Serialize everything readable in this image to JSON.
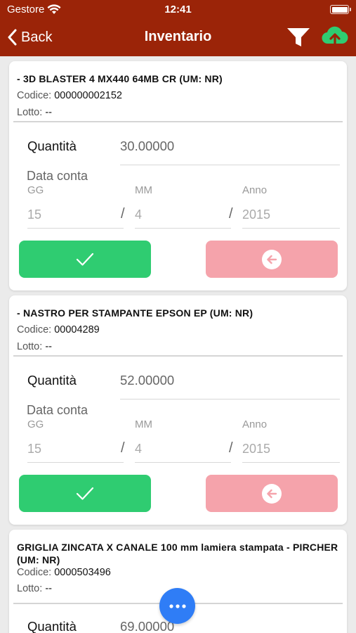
{
  "status_bar": {
    "carrier": "Gestore",
    "time": "12:41"
  },
  "nav": {
    "back_label": "Back",
    "title": "Inventario"
  },
  "colors": {
    "header": "#9b2408",
    "confirm": "#2fcc71",
    "back_button": "#f5a3ab",
    "fab": "#2f7df6",
    "upload_icon": "#2fcc71"
  },
  "icons": {
    "filter": "filter-icon",
    "upload": "cloud-upload-icon",
    "confirm": "checkmark-icon",
    "back": "arrow-left-circle-icon",
    "more": "more-dots-icon"
  },
  "labels": {
    "codice": "Codice:",
    "lotto": "Lotto:",
    "quantita": "Quantità",
    "data_conta": "Data conta",
    "gg": "GG",
    "mm": "MM",
    "anno": "Anno",
    "slash": "/"
  },
  "items": [
    {
      "title": "- 3D BLASTER 4 MX440 64MB CR (UM: NR)",
      "codice": "000000002152",
      "lotto": "--",
      "quantita": "30.00000",
      "gg": "15",
      "mm": "4",
      "anno": "2015"
    },
    {
      "title": "- NASTRO PER STAMPANTE EPSON EP (UM: NR)",
      "codice": "00004289",
      "lotto": "--",
      "quantita": "52.00000",
      "gg": "15",
      "mm": "4",
      "anno": "2015"
    },
    {
      "title": "GRIGLIA ZINCATA X CANALE 100 mm lamiera stampata - PIRCHER (UM: NR)",
      "codice": "0000503496",
      "lotto": "--",
      "quantita": "69.00000"
    }
  ]
}
